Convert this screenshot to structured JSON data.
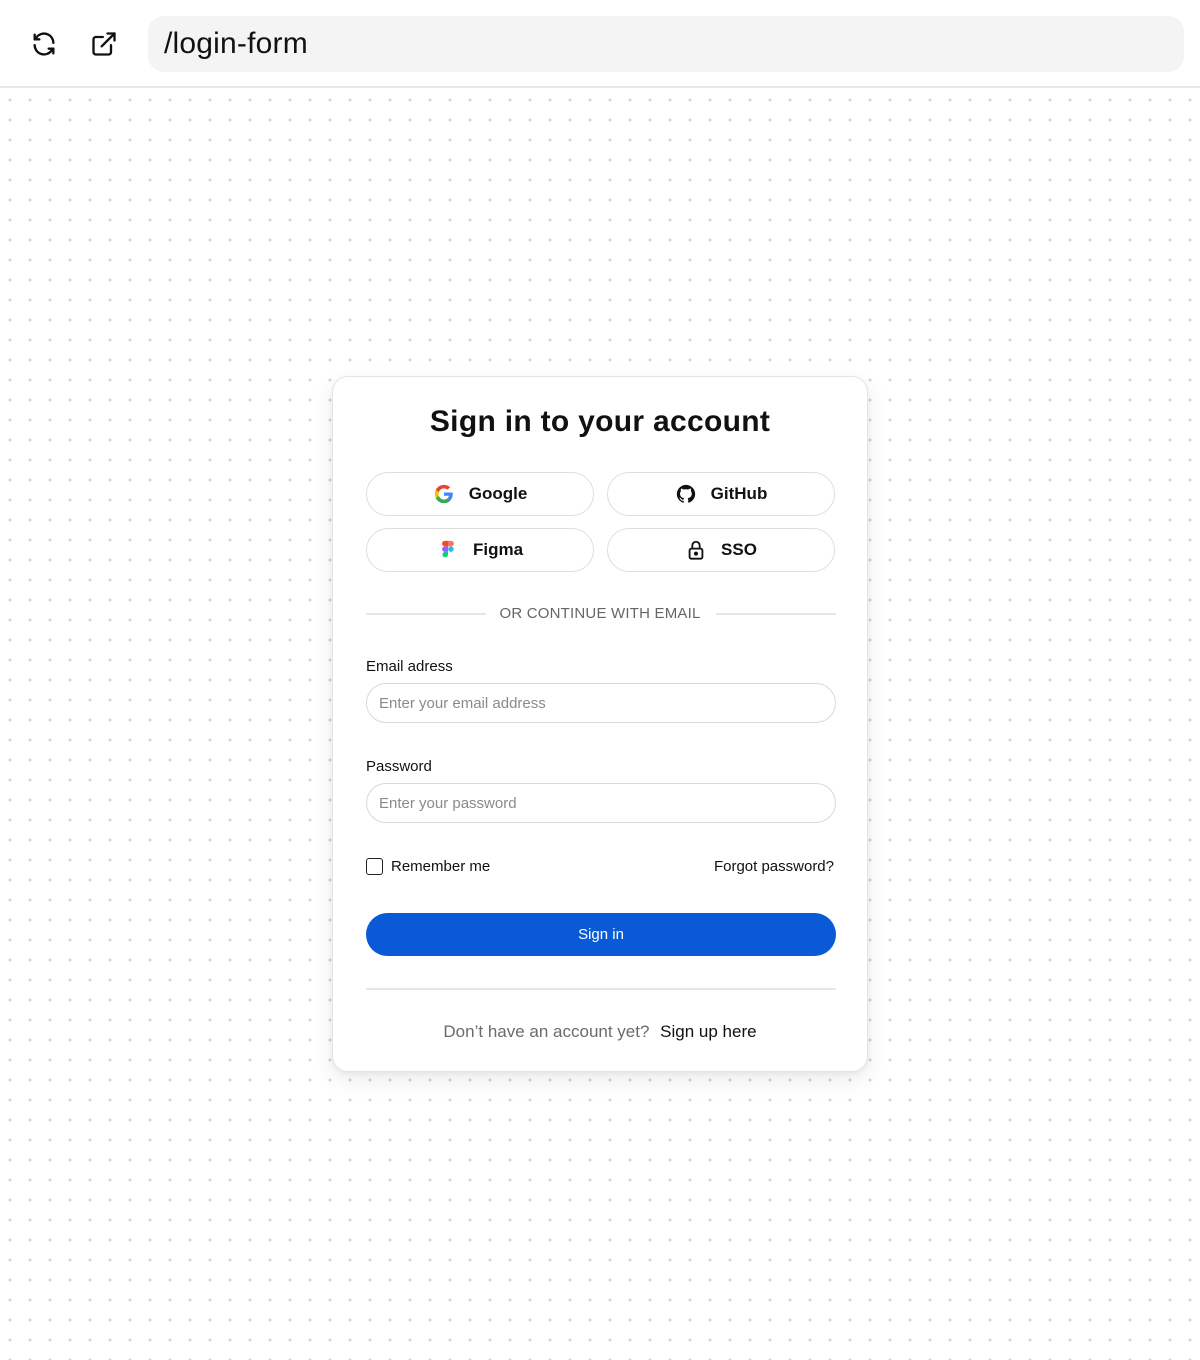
{
  "toolbar": {
    "refresh_icon": "refresh-icon",
    "open_external_icon": "external-link-icon",
    "url": "/login-form"
  },
  "card": {
    "title": "Sign in to your account",
    "social": [
      {
        "label": "Google",
        "icon": "google-icon"
      },
      {
        "label": "GitHub",
        "icon": "github-icon"
      },
      {
        "label": "Figma",
        "icon": "figma-icon"
      },
      {
        "label": "SSO",
        "icon": "lock-icon"
      }
    ],
    "divider": "OR CONTINUE WITH EMAIL",
    "email": {
      "label": "Email adress",
      "placeholder": "Enter your email address",
      "value": ""
    },
    "password": {
      "label": "Password",
      "placeholder": "Enter your password",
      "value": ""
    },
    "remember_label": "Remember me",
    "remember_checked": false,
    "forgot_label": "Forgot password?",
    "signin_label": "Sign in",
    "footer_text": "Don’t have an account yet?",
    "signup_label": "Sign up here"
  },
  "colors": {
    "primary": "#0a5ad7",
    "background_dots": "#d4d4d4"
  }
}
